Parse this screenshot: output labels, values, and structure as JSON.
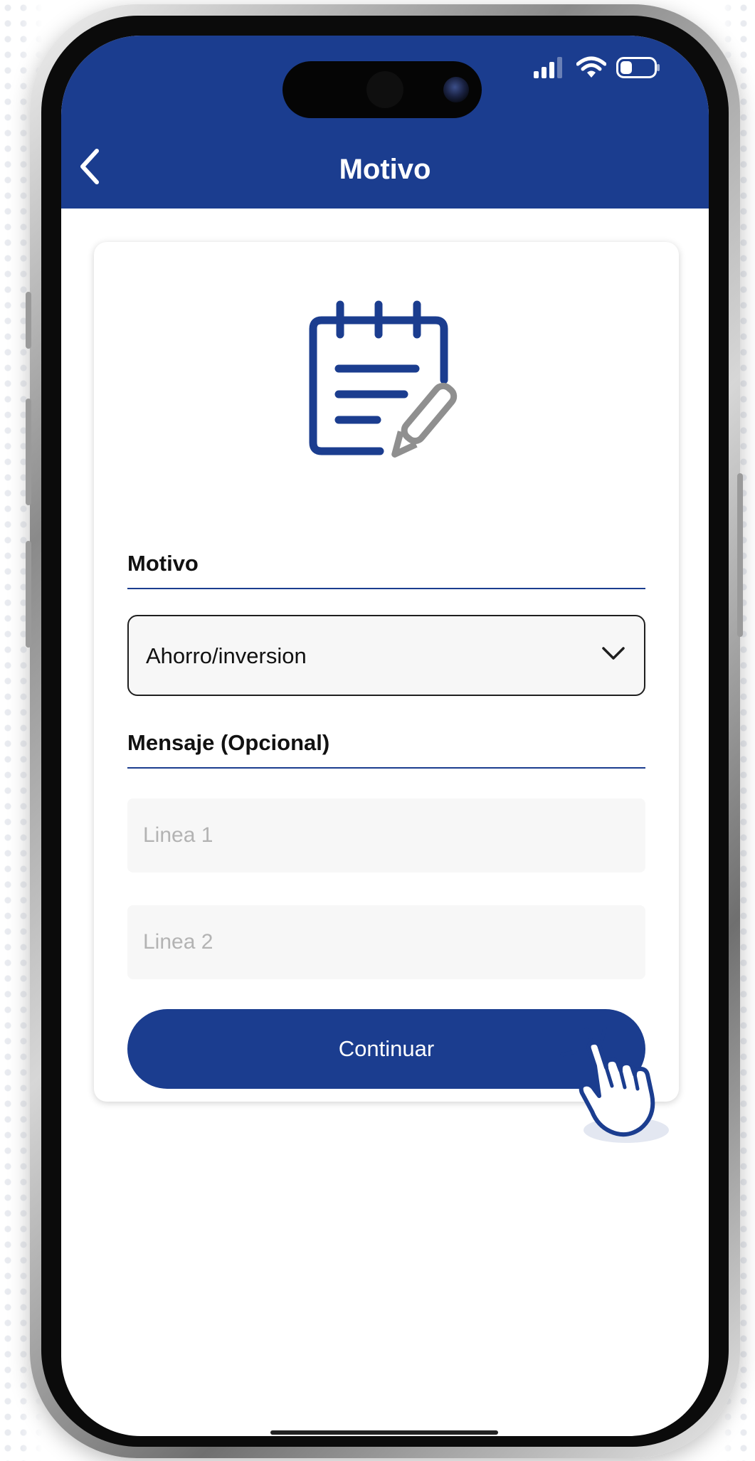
{
  "header": {
    "title": "Motivo"
  },
  "form": {
    "motivo_label": "Motivo",
    "motivo_selected": "Ahorro/inversion",
    "mensaje_label": "Mensaje (Opcional)",
    "line1_placeholder": "Linea 1",
    "line2_placeholder": "Linea 2",
    "continue_label": "Continuar"
  },
  "icons": {
    "back": "chevron-left-icon",
    "notepad": "notepad-edit-icon",
    "dropdown": "chevron-down-icon",
    "tap_hint": "hand-pointer-icon",
    "signal": "signal-icon",
    "wifi": "wifi-icon",
    "battery": "battery-icon"
  },
  "colors": {
    "primary": "#1b3d8f",
    "background": "#ffffff",
    "field_background": "#f7f7f7",
    "placeholder": "#b3b3b3"
  }
}
